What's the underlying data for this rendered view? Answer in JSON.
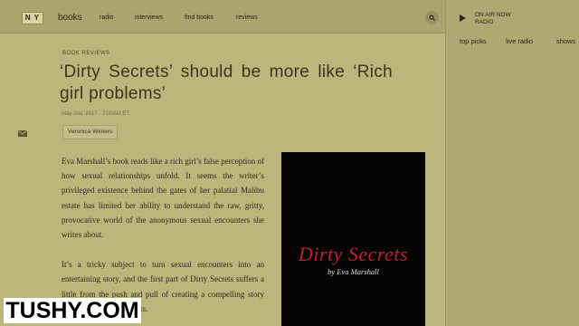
{
  "header": {
    "logo": "N Y",
    "nav": [
      "books",
      "radio",
      "interviews",
      "find books",
      "reviews"
    ]
  },
  "radio": {
    "status_line1": "ON AIR NOW",
    "status_line2": "RADIO",
    "links": [
      "top picks",
      "live radio",
      "shows"
    ]
  },
  "article": {
    "kicker": "BOOK REVIEWS",
    "title": "‘Dirty Secrets’ should be more like ‘Rich girl problems’",
    "date": "May 2nd, 2017 - 7:00AM ET",
    "author": "Veronica Winters",
    "paragraphs": [
      "Eva Marshall’s book reads like a rich girl’s false perception of how sexual relationships unfold. It seems the writer’s privileged existence behind the gates of her palatial Malibu estate has limited her ability to understand the raw, gritty, provocative world of the anonymous sexual encounters she writes about.",
      "It’s a tricky subject to turn sexual encounters into an entertaining story, and the first part of Dirty Secrets suffers a little from the push and pull of creating a compelling story while staying true to facts."
    ],
    "cover": {
      "title": "Dirty Secrets",
      "author": "by Eva Marshall"
    }
  },
  "watermark": "TUSHY.COM",
  "colors": {
    "background": "#bcb67d",
    "cover_title": "#c51c2d"
  }
}
